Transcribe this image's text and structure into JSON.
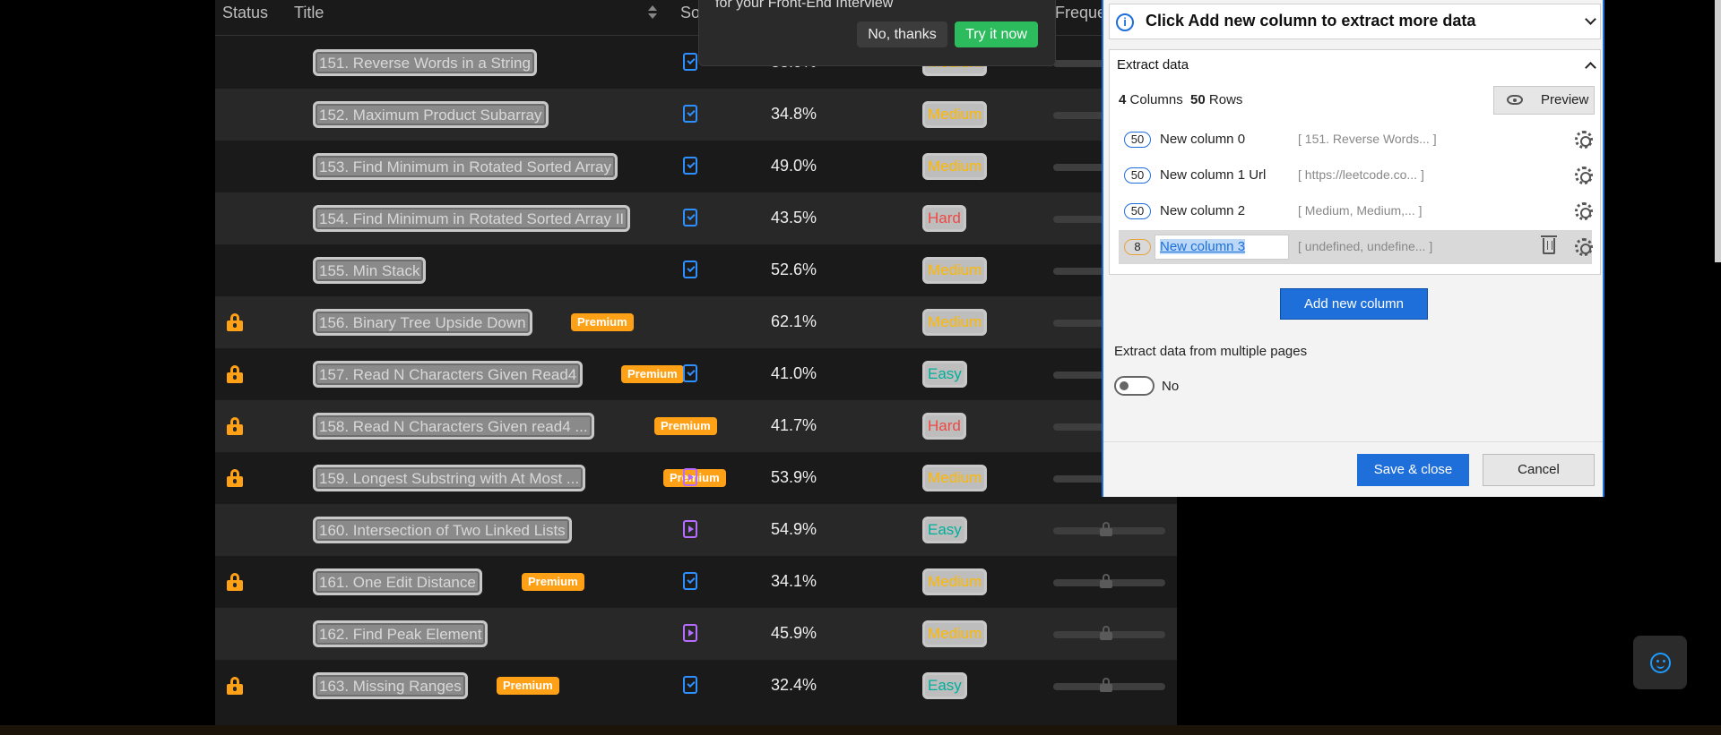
{
  "table": {
    "headers": {
      "status": "Status",
      "title": "Title",
      "solution": "So",
      "frequency": "Freque"
    },
    "rows": [
      {
        "title": "151. Reverse Words in a String",
        "premium": "",
        "solution": "check",
        "acceptance": "33.9%",
        "difficulty": "Medium",
        "locked": false,
        "freq_locked": false
      },
      {
        "title": "152. Maximum Product Subarray",
        "premium": "",
        "solution": "check",
        "acceptance": "34.8%",
        "difficulty": "Medium",
        "locked": false,
        "freq_locked": false
      },
      {
        "title": "153. Find Minimum in Rotated Sorted Array",
        "premium": "",
        "solution": "check",
        "acceptance": "49.0%",
        "difficulty": "Medium",
        "locked": false,
        "freq_locked": false
      },
      {
        "title": "154. Find Minimum in Rotated Sorted Array II",
        "premium": "",
        "solution": "check",
        "acceptance": "43.5%",
        "difficulty": "Hard",
        "locked": false,
        "freq_locked": false
      },
      {
        "title": "155. Min Stack",
        "premium": "",
        "solution": "check",
        "acceptance": "52.6%",
        "difficulty": "Medium",
        "locked": false,
        "freq_locked": false
      },
      {
        "title": "156. Binary Tree Upside Down",
        "premium": "Premium",
        "solution": "",
        "acceptance": "62.1%",
        "difficulty": "Medium",
        "locked": true,
        "freq_locked": false
      },
      {
        "title": "157. Read N Characters Given Read4",
        "premium": "Premium",
        "solution": "check",
        "acceptance": "41.0%",
        "difficulty": "Easy",
        "locked": true,
        "freq_locked": false
      },
      {
        "title": "158. Read N Characters Given read4 ...",
        "premium": "Premium",
        "solution": "",
        "acceptance": "41.7%",
        "difficulty": "Hard",
        "locked": true,
        "freq_locked": false
      },
      {
        "title": "159. Longest Substring with At Most ...",
        "premium": "Premium",
        "solution": "video",
        "acceptance": "53.9%",
        "difficulty": "Medium",
        "locked": true,
        "freq_locked": false
      },
      {
        "title": "160. Intersection of Two Linked Lists",
        "premium": "",
        "solution": "video",
        "acceptance": "54.9%",
        "difficulty": "Easy",
        "locked": false,
        "freq_locked": true
      },
      {
        "title": "161. One Edit Distance",
        "premium": "Premium",
        "solution": "check",
        "acceptance": "34.1%",
        "difficulty": "Medium",
        "locked": true,
        "freq_locked": true
      },
      {
        "title": "162. Find Peak Element",
        "premium": "",
        "solution": "video",
        "acceptance": "45.9%",
        "difficulty": "Medium",
        "locked": false,
        "freq_locked": true
      },
      {
        "title": "163. Missing Ranges",
        "premium": "Premium",
        "solution": "check",
        "acceptance": "32.4%",
        "difficulty": "Easy",
        "locked": true,
        "freq_locked": true
      }
    ]
  },
  "promo": {
    "text": "for your Front-End Interview",
    "no_label": "No, thanks",
    "try_label": "Try it now"
  },
  "panel": {
    "tip": "Click Add new column to extract more data",
    "section_title": "Extract data",
    "columns_count": "4",
    "columns_word": "Columns",
    "rows_count": "50",
    "rows_word": "Rows",
    "preview_label": "Preview",
    "columns": [
      {
        "count": "50",
        "name": "New column 0",
        "preview": "[ 151. Reverse Words...  ]"
      },
      {
        "count": "50",
        "name": "New column 1 Url",
        "preview": "[ https://leetcode.co...  ]"
      },
      {
        "count": "50",
        "name": "New column 2",
        "preview": "[ Medium, Medium,...   ]"
      },
      {
        "count": "8",
        "name": "New column 3",
        "preview": "[ undefined, undefine... ]"
      }
    ],
    "add_column_label": "Add new column",
    "multi_pages_label": "Extract data from multiple pages",
    "toggle_label": "No",
    "save_label": "Save & close",
    "cancel_label": "Cancel"
  },
  "colors": {
    "premium": "#ffa116",
    "medium": "#ffb800",
    "hard": "#ef4743",
    "easy": "#00af9b",
    "accent": "#1e6fd9",
    "try_button": "#2cbb5d"
  }
}
